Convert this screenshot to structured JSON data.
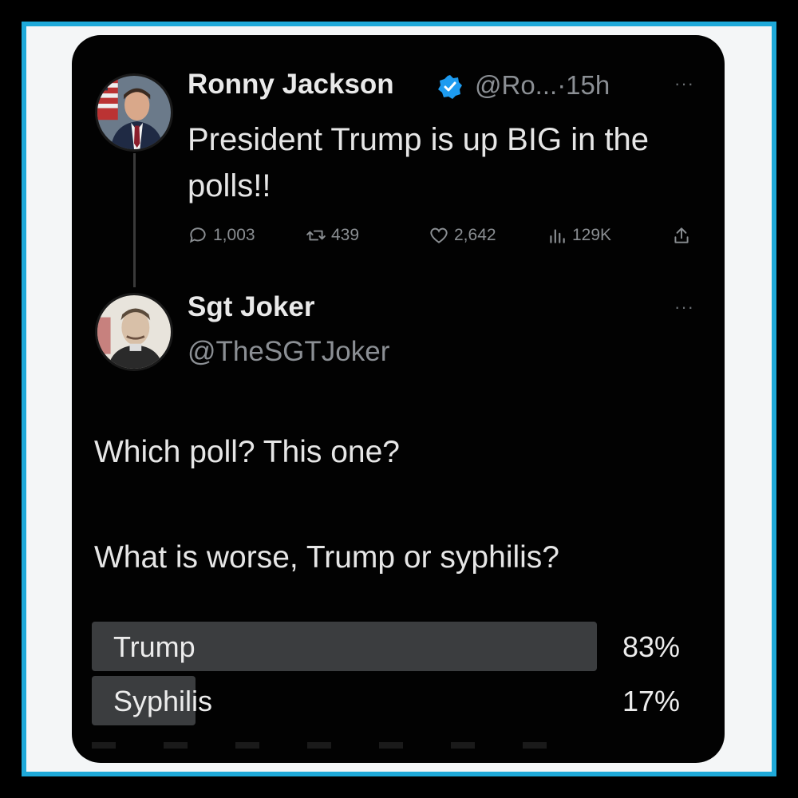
{
  "colors": {
    "frame_border": "#1ea9d9",
    "card_background": "#020202",
    "verified_badge": "#1d9bf0",
    "poll_fill": "#3b3d3f"
  },
  "tweet1": {
    "author": "Ronny Jackson",
    "verified_icon": "verified-badge-icon",
    "handle_time": "@Ro...·15h",
    "more": "···",
    "text": "President Trump is up BIG in the polls!!",
    "actions": {
      "replies": "1,003",
      "retweets": "439",
      "likes": "2,642",
      "views": "129K"
    }
  },
  "tweet2": {
    "author": "Sgt Joker",
    "handle": "@TheSGTJoker",
    "more": "···",
    "line1": "Which poll? This one?",
    "line2": "What is worse, Trump or syphilis?",
    "poll": [
      {
        "label": "Trump",
        "percent_text": "83%",
        "percent": 83
      },
      {
        "label": "Syphilis",
        "percent_text": "17%",
        "percent": 17
      }
    ]
  }
}
